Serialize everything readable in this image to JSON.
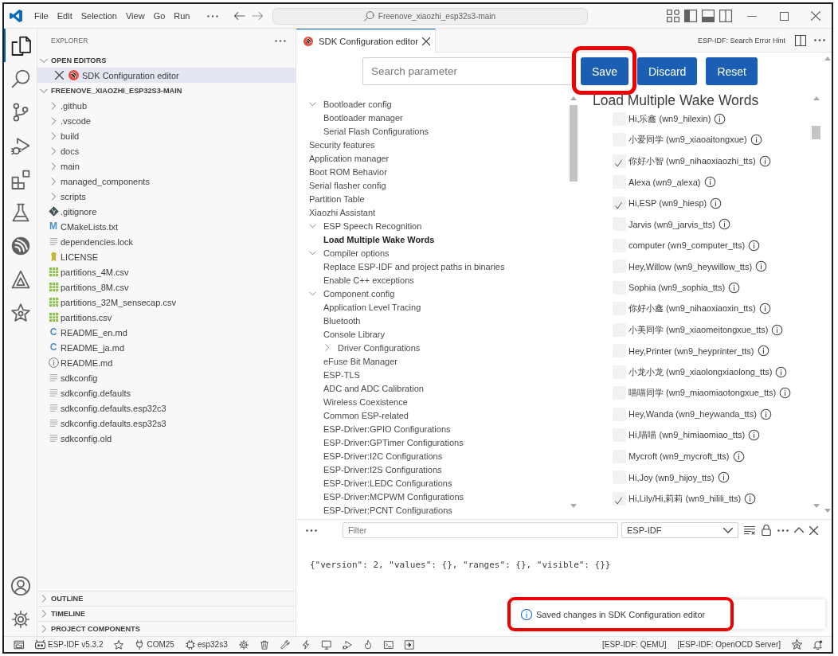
{
  "title_bar": {
    "menus": [
      "File",
      "Edit",
      "Selection",
      "View",
      "Go",
      "Run"
    ],
    "search": "Freenove_xiaozhi_esp32s3-main"
  },
  "activity_bar": [
    {
      "selected": true
    },
    {
      "selected": false
    },
    {
      "selected": false
    },
    {
      "selected": false
    },
    {
      "selected": false
    },
    {
      "selected": false
    },
    {
      "selected": false
    },
    {
      "selected": false
    },
    {
      "selected": false
    }
  ],
  "sidebar": {
    "title": "EXPLORER",
    "open_editors": {
      "label": "OPEN EDITORS",
      "expanded": true,
      "items": [
        {
          "name": "SDK Configuration editor",
          "selected": true
        }
      ]
    },
    "folder": {
      "label": "FREENOVE_XIAOZHI_ESP32S3-MAIN",
      "expanded": true,
      "items": [
        {
          "name": ".github",
          "kind": "folder",
          "expanded": false,
          "selected": false
        },
        {
          "name": ".vscode",
          "kind": "folder",
          "expanded": false,
          "selected": false
        },
        {
          "name": "build",
          "kind": "folder",
          "expanded": false,
          "selected": false
        },
        {
          "name": "docs",
          "kind": "folder",
          "expanded": false,
          "selected": false
        },
        {
          "name": "main",
          "kind": "folder",
          "expanded": false,
          "selected": false
        },
        {
          "name": "managed_components",
          "kind": "folder",
          "expanded": false,
          "selected": false
        },
        {
          "name": "scripts",
          "kind": "folder",
          "expanded": false,
          "selected": false
        },
        {
          "name": ".gitignore",
          "kind": "git",
          "selected": false
        },
        {
          "name": "CMakeLists.txt",
          "kind": "letter",
          "glyph": "M",
          "selected": false
        },
        {
          "name": "dependencies.lock",
          "kind": "lines",
          "selected": false
        },
        {
          "name": "LICENSE",
          "kind": "license",
          "selected": false
        },
        {
          "name": "partitions_4M.csv",
          "kind": "sheet",
          "selected": false
        },
        {
          "name": "partitions_8M.csv",
          "kind": "sheet",
          "selected": false
        },
        {
          "name": "partitions_32M_sensecap.csv",
          "kind": "sheet",
          "selected": false
        },
        {
          "name": "partitions.csv",
          "kind": "sheet",
          "selected": false
        },
        {
          "name": "README_en.md",
          "kind": "letter",
          "glyph": "C",
          "selected": false
        },
        {
          "name": "README_ja.md",
          "kind": "letter",
          "glyph": "C",
          "selected": false
        },
        {
          "name": "README.md",
          "kind": "info",
          "selected": false
        },
        {
          "name": "sdkconfig",
          "kind": "lines",
          "selected": false
        },
        {
          "name": "sdkconfig.defaults",
          "kind": "lines",
          "selected": false
        },
        {
          "name": "sdkconfig.defaults.esp32c3",
          "kind": "lines",
          "selected": false
        },
        {
          "name": "sdkconfig.defaults.esp32s3",
          "kind": "lines",
          "selected": false
        },
        {
          "name": "sdkconfig.old",
          "kind": "lines",
          "selected": false
        }
      ]
    },
    "sections": [
      {
        "label": "OUTLINE",
        "expanded": false
      },
      {
        "label": "TIMELINE",
        "expanded": false
      },
      {
        "label": "PROJECT COMPONENTS",
        "expanded": false
      }
    ]
  },
  "editor": {
    "tabs": [
      {
        "label": "SDK Configuration editor",
        "selected": true
      }
    ],
    "hint": "ESP-IDF: Search Error Hint",
    "search": {
      "placeholder": "Search parameter"
    },
    "buttons": [
      {
        "label": "Save",
        "highlighted": true
      },
      {
        "label": "Discard"
      },
      {
        "label": "Reset"
      }
    ],
    "tree": [
      {
        "label": "Bootloader config",
        "expanded": true,
        "selected": false,
        "children": [
          {
            "label": "Bootloader manager",
            "selected": false
          },
          {
            "label": "Serial Flash Configurations",
            "selected": false
          }
        ]
      },
      {
        "label": "Security features",
        "selected": false
      },
      {
        "label": "Application manager",
        "selected": false
      },
      {
        "label": "Boot ROM Behavior",
        "selected": false
      },
      {
        "label": "Serial flasher config",
        "selected": false
      },
      {
        "label": "Partition Table",
        "selected": false
      },
      {
        "label": "Xiaozhi Assistant",
        "selected": false
      },
      {
        "label": "ESP Speech Recognition",
        "expanded": true,
        "selected": false,
        "children": [
          {
            "label": "Load Multiple Wake Words",
            "selected": true
          }
        ]
      },
      {
        "label": "Compiler options",
        "expanded": true,
        "selected": false,
        "children": [
          {
            "label": "Replace ESP-IDF and project paths in binaries",
            "selected": false
          },
          {
            "label": "Enable C++ exceptions",
            "selected": false
          }
        ]
      },
      {
        "label": "Component config",
        "expanded": true,
        "selected": false,
        "children": [
          {
            "label": "Application Level Tracing",
            "selected": false
          },
          {
            "label": "Bluetooth",
            "selected": false
          },
          {
            "label": "Console Library",
            "selected": false
          },
          {
            "label": "Driver Configurations",
            "expanded": false,
            "selected": false
          },
          {
            "label": "eFuse Bit Manager",
            "selected": false
          },
          {
            "label": "ESP-TLS",
            "selected": false
          },
          {
            "label": "ADC and ADC Calibration",
            "selected": false
          },
          {
            "label": "Wireless Coexistence",
            "selected": false
          },
          {
            "label": "Common ESP-related",
            "selected": false
          },
          {
            "label": "ESP-Driver:GPIO Configurations",
            "selected": false
          },
          {
            "label": "ESP-Driver:GPTimer Configurations",
            "selected": false
          },
          {
            "label": "ESP-Driver:I2C Configurations",
            "selected": false
          },
          {
            "label": "ESP-Driver:I2S Configurations",
            "selected": false
          },
          {
            "label": "ESP-Driver:LEDC Configurations",
            "selected": false
          },
          {
            "label": "ESP-Driver:MCPWM Configurations",
            "selected": false
          },
          {
            "label": "ESP-Driver:PCNT Configurations",
            "selected": false
          }
        ]
      }
    ],
    "section": {
      "title": "Load Multiple Wake Words",
      "options": [
        {
          "label": "Hi,乐鑫 (wn9_hilexin)",
          "checked": false
        },
        {
          "label": "小爱同学 (wn9_xiaoaitongxue)",
          "checked": false
        },
        {
          "label": "你好小智 (wn9_nihaoxiaozhi_tts)",
          "checked": true
        },
        {
          "label": "Alexa (wn9_alexa)",
          "checked": false
        },
        {
          "label": "Hi,ESP (wn9_hiesp)",
          "checked": true
        },
        {
          "label": "Jarvis (wn9_jarvis_tts)",
          "checked": false
        },
        {
          "label": "computer (wn9_computer_tts)",
          "checked": false
        },
        {
          "label": "Hey,Willow (wn9_heywillow_tts)",
          "checked": false
        },
        {
          "label": "Sophia (wn9_sophia_tts)",
          "checked": false
        },
        {
          "label": "你好小鑫 (wn9_nihaoxiaoxin_tts)",
          "checked": false
        },
        {
          "label": "小美同学 (wn9_xiaomeitongxue_tts)",
          "checked": false
        },
        {
          "label": "Hey,Printer (wn9_heyprinter_tts)",
          "checked": false
        },
        {
          "label": "小龙小龙 (wn9_xiaolongxiaolong_tts)",
          "checked": false
        },
        {
          "label": "喵喵同学 (wn9_miaomiaotongxue_tts)",
          "checked": false
        },
        {
          "label": "Hey,Wanda (wn9_heywanda_tts)",
          "checked": false
        },
        {
          "label": "Hi,喵喵 (wn9_himiaomiao_tts)",
          "checked": false
        },
        {
          "label": "Mycroft (wn9_mycroft_tts)",
          "checked": false
        },
        {
          "label": "Hi,Joy (wn9_hijoy_tts)",
          "checked": false
        },
        {
          "label": "Hi,Lily/Hi,莉莉 (wn9_hilili_tts)",
          "checked": true
        }
      ]
    }
  },
  "panel": {
    "filter": {
      "placeholder": "Filter"
    },
    "channel": "ESP-IDF",
    "output": "{\"version\": 2, \"values\": {}, \"ranges\": {}, \"visible\": {}}"
  },
  "notification": {
    "text": "Saved changes in SDK Configuration editor",
    "highlighted": true
  },
  "status_bar": {
    "idf": "ESP-IDF v5.3.2",
    "port": "COM25",
    "target": "esp32s3",
    "right": [
      "[ESP-IDF: QEMU]",
      "[ESP-IDF: OpenOCD Server]"
    ]
  }
}
